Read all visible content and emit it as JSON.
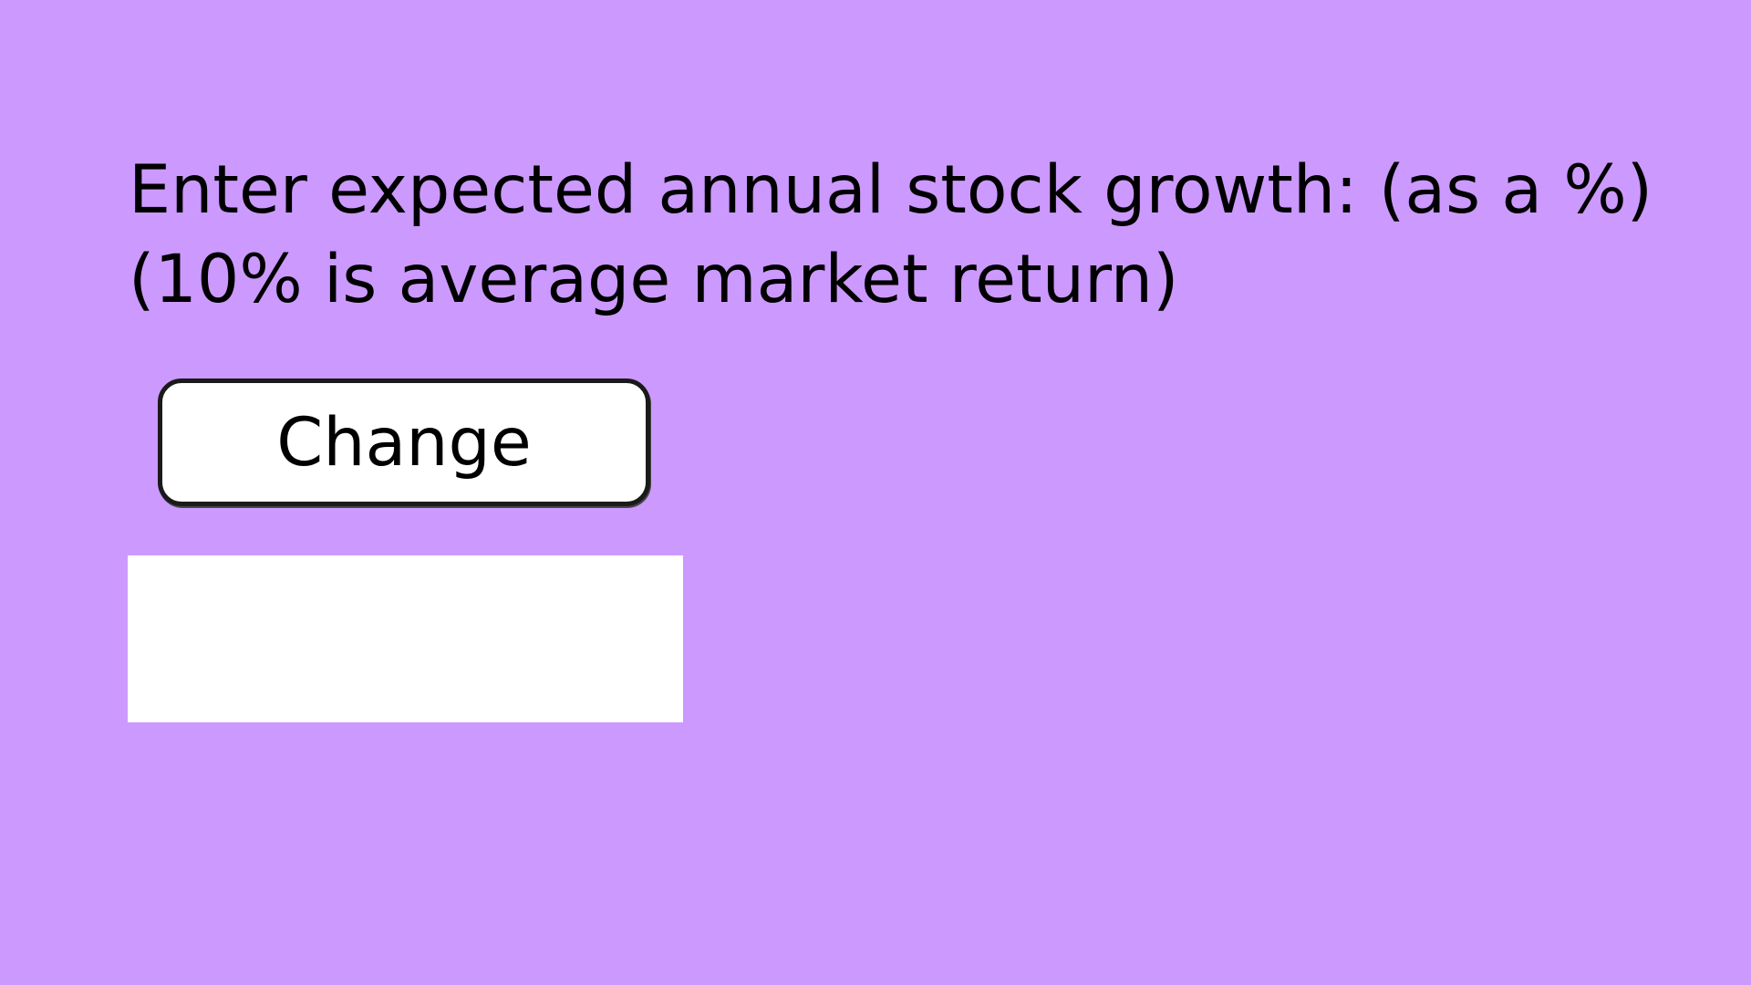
{
  "prompt": {
    "line1": "Enter expected annual stock growth: (as a %)",
    "line2": "(10% is average market return)"
  },
  "change_button": {
    "label": "Change"
  },
  "growth_input": {
    "value": "",
    "placeholder": ""
  },
  "colors": {
    "background": "#cc99ff",
    "input_background": "#ffffff",
    "button_background": "#ffffff",
    "text": "#000000"
  }
}
